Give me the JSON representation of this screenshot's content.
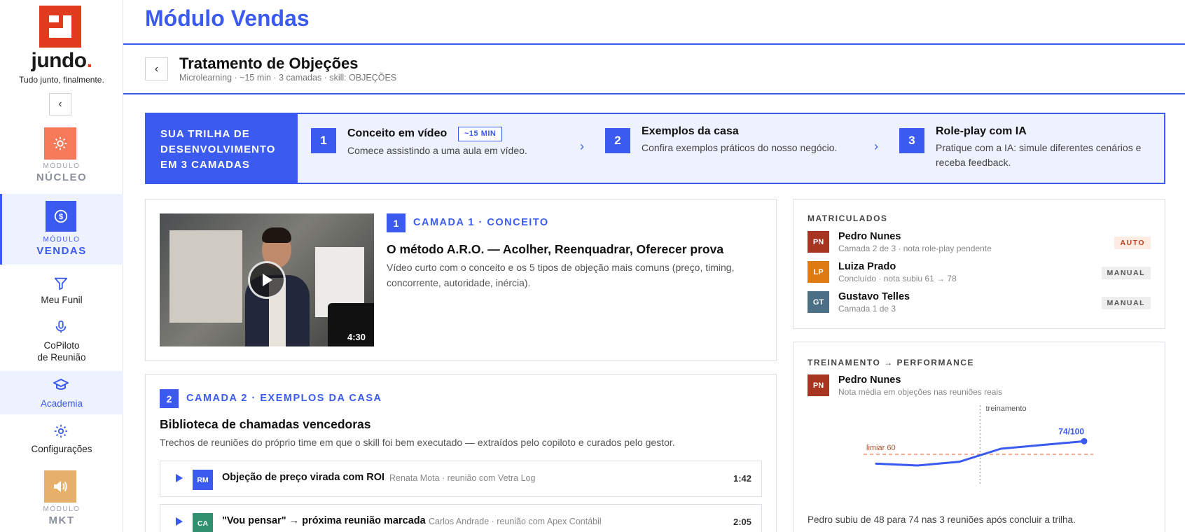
{
  "sidebar": {
    "brand": "jundo",
    "brand_dot": ".",
    "tagline": "Tudo junto, finalmente.",
    "collapse_icon": "‹",
    "modules": [
      {
        "small": "MÓDULO",
        "big": "NÚCLEO",
        "color": "#f47a5a",
        "icon": "sun-icon"
      },
      {
        "small": "MÓDULO",
        "big": "VENDAS",
        "color": "#3b5bf0",
        "icon": "dollar-coin-icon",
        "active": true
      },
      {
        "small": "MÓDULO",
        "big": "MKT",
        "color": "#e6b06a",
        "icon": "speaker-icon"
      }
    ],
    "nav": [
      {
        "label": "Meu Funil",
        "icon": "funnel-icon"
      },
      {
        "label_l1": "CoPiloto",
        "label_l2": "de Reunião",
        "icon": "microphone-icon"
      },
      {
        "label": "Academia",
        "icon": "graduation-cap-icon",
        "active": true
      },
      {
        "label": "Configurações",
        "icon": "gear-icon"
      }
    ]
  },
  "header": {
    "title": "Módulo Vendas",
    "back_icon": "‹",
    "page_title": "Tratamento de Objeções",
    "page_meta": "Microlearning · ~15 min · 3 camadas · skill: OBJEÇÕES"
  },
  "track": {
    "label_l1": "SUA TRILHA DE",
    "label_l2": "DESENVOLVIMENTO",
    "label_l3": "EM 3 CAMADAS",
    "steps": [
      {
        "num": "1",
        "title": "Conceito em vídeo",
        "badge": "~15 MIN",
        "desc": "Comece assistindo a uma aula em vídeo."
      },
      {
        "num": "2",
        "title": "Exemplos da casa",
        "desc": "Confira exemplos práticos do nosso negócio."
      },
      {
        "num": "3",
        "title": "Role-play com IA",
        "desc": "Pratique com a IA: simule diferentes cenários e receba feedback."
      }
    ]
  },
  "layer1": {
    "num": "1",
    "label": "CAMADA 1 · CONCEITO",
    "title": "O método A.R.O. — Acolher, Reenquadrar, Oferecer prova",
    "desc": "Vídeo curto com o conceito e os 5 tipos de objeção mais comuns (preço, timing, concorrente, autoridade, inércia).",
    "video_duration": "4:30"
  },
  "layer2": {
    "num": "2",
    "label": "CAMADA 2 · EXEMPLOS DA CASA",
    "title": "Biblioteca de chamadas vencedoras",
    "desc": "Trechos de reuniões do próprio time em que o skill foi bem executado — extraídos pelo copiloto e curados pelo gestor.",
    "calls": [
      {
        "initials": "RM",
        "color": "#3b5bf0",
        "title": "Objeção de preço virada com ROI",
        "sub": "Renata Mota · reunião com Vetra Log",
        "duration": "1:42"
      },
      {
        "initials": "CA",
        "color": "#2f8f6f",
        "title": "\"Vou pensar\" → próxima reunião marcada",
        "sub": "Carlos Andrade · reunião com Apex Contábil",
        "duration": "2:05"
      }
    ]
  },
  "enrolled": {
    "heading": "MATRICULADOS",
    "people": [
      {
        "initials": "PN",
        "color": "#a8351f",
        "name": "Pedro Nunes",
        "sub": "Camada 2 de 3 · nota role-play pendente",
        "tag": "AUTO"
      },
      {
        "initials": "LP",
        "color": "#e07a12",
        "name": "Luiza Prado",
        "sub": "Concluído · nota subiu 61 → 78",
        "tag": "MANUAL"
      },
      {
        "initials": "GT",
        "color": "#4a6f86",
        "name": "Gustavo Telles",
        "sub": "Camada 1 de 3",
        "tag": "MANUAL"
      }
    ]
  },
  "performance": {
    "heading": "TREINAMENTO → PERFORMANCE",
    "person_initials": "PN",
    "person_color": "#a8351f",
    "person_name": "Pedro Nunes",
    "person_sub": "Nota média em objeções nas reuniões reais",
    "note": "Pedro subiu de 48 para 74 nas 3 reuniões após concluir a trilha."
  },
  "chart_data": {
    "type": "line",
    "x": [
      1,
      2,
      3,
      4,
      5,
      6
    ],
    "series": [
      {
        "values": [
          50,
          48,
          52,
          66,
          70,
          74
        ]
      }
    ],
    "ylim": [
      30,
      90
    ],
    "threshold": {
      "label": "limiar 60",
      "value": 60
    },
    "marker": {
      "label": "treinamento",
      "x": 3.5
    },
    "end_label": "74/100"
  }
}
